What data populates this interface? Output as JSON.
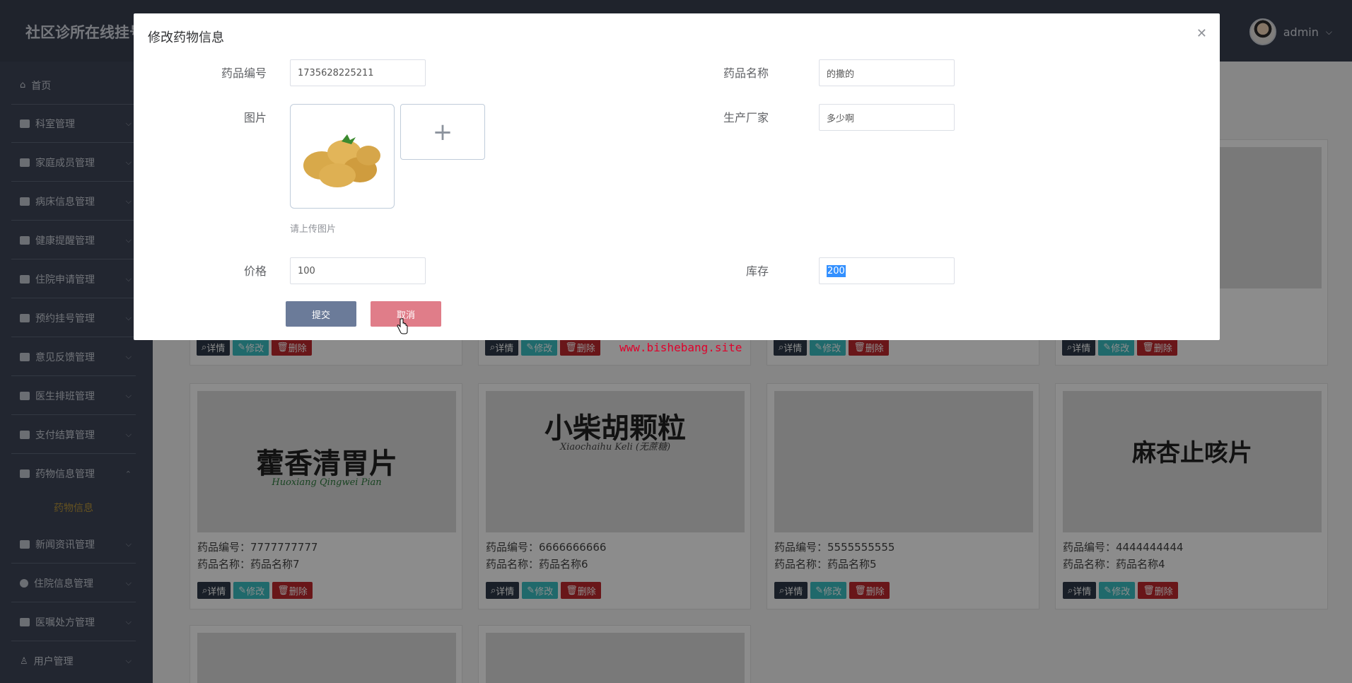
{
  "app": {
    "title": "社区诊所在线挂号",
    "user": "admin"
  },
  "sidebar": {
    "items": [
      {
        "label": "首页"
      },
      {
        "label": "科室管理"
      },
      {
        "label": "家庭成员管理"
      },
      {
        "label": "病床信息管理"
      },
      {
        "label": "健康提醒管理"
      },
      {
        "label": "住院申请管理"
      },
      {
        "label": "预约挂号管理"
      },
      {
        "label": "意见反馈管理"
      },
      {
        "label": "医生排班管理"
      },
      {
        "label": "支付结算管理"
      },
      {
        "label": "药物信息管理"
      },
      {
        "label": "新闻资讯管理"
      },
      {
        "label": "住院信息管理"
      },
      {
        "label": "医嘱处方管理"
      },
      {
        "label": "用户管理"
      }
    ],
    "active_sub": "药物信息"
  },
  "cards": [
    {
      "code_label": "药品编号：7777777777",
      "name_label": "药品名称：药品名称7",
      "img_text": "藿香清胃片",
      "img_sub": "Huoxiang Qingwei Pian"
    },
    {
      "code_label": "药品编号：6666666666",
      "name_label": "药品名称：药品名称6",
      "img_text": "小柴胡颗粒",
      "img_sub": "Xiaochaihu Keli (无蔗糖)"
    },
    {
      "code_label": "药品编号：5555555555",
      "name_label": "药品名称：药品名称5",
      "img_text": "",
      "img_sub": ""
    },
    {
      "code_label": "药品编号：4444444444",
      "name_label": "药品名称：药品名称4",
      "img_text": "麻杏止咳片",
      "img_sub": ""
    }
  ],
  "card_buttons": {
    "detail": "详情",
    "edit": "修改",
    "delete": "删除"
  },
  "watermark": "www.bishebang.site",
  "modal": {
    "title": "修改药物信息",
    "close_icon": "close-icon",
    "fields": {
      "code": {
        "label": "药品编号",
        "value": "1735628225211"
      },
      "name": {
        "label": "药品名称",
        "value": "的撒的"
      },
      "image": {
        "label": "图片",
        "hint": "请上传图片"
      },
      "maker": {
        "label": "生产厂家",
        "value": "多少啊"
      },
      "price": {
        "label": "价格",
        "value": "100"
      },
      "stock": {
        "label": "库存",
        "value": "200"
      }
    },
    "submit_label": "提交",
    "cancel_label": "取消"
  }
}
